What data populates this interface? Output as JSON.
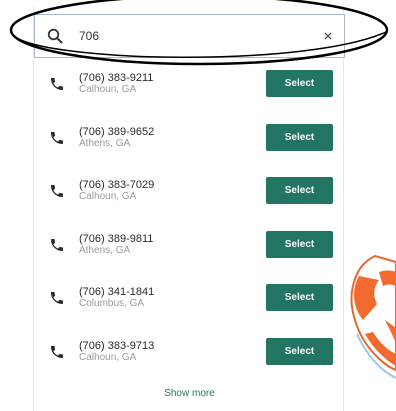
{
  "search": {
    "value": "706",
    "placeholder": ""
  },
  "results": [
    {
      "number": "(706) 383-9211",
      "location": "Calhoun, GA",
      "action": "Select"
    },
    {
      "number": "(706) 389-9652",
      "location": "Athens, GA",
      "action": "Select"
    },
    {
      "number": "(706) 383-7029",
      "location": "Calhoun, GA",
      "action": "Select"
    },
    {
      "number": "(706) 389-9811",
      "location": "Athens, GA",
      "action": "Select"
    },
    {
      "number": "(706) 341-1841",
      "location": "Columbus, GA",
      "action": "Select"
    },
    {
      "number": "(706) 383-9713",
      "location": "Calhoun, GA",
      "action": "Select"
    }
  ],
  "show_more_label": "Show more",
  "icons": {
    "search": "search-icon",
    "clear": "close-icon",
    "phone": "phone-icon"
  },
  "colors": {
    "accent": "#217562",
    "secondary_text": "#9a9a9a",
    "search_border": "#a9b8d2",
    "annotation": "#000000"
  }
}
